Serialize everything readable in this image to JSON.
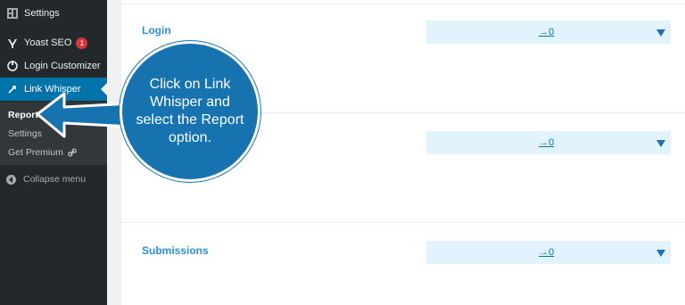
{
  "sidebar": {
    "items": [
      {
        "label": "Settings",
        "icon": "settings-icon"
      },
      {
        "label": "Yoast SEO",
        "icon": "yoast-icon",
        "badge": "1"
      },
      {
        "label": "Login Customizer",
        "icon": "customizer-icon"
      },
      {
        "label": "Link Whisper",
        "icon": "link-whisper-icon",
        "active": true
      }
    ],
    "submenu": [
      "Report",
      "Settings",
      "Get Premium"
    ],
    "collapse_label": "Collapse menu"
  },
  "main": {
    "rows": [
      {
        "label": "Login",
        "value": "→0"
      },
      {
        "label": "",
        "value": "→0"
      },
      {
        "label": "Submissions",
        "value": "→0"
      }
    ]
  },
  "callout": {
    "text": "Click on Link Whisper and select the Report option."
  },
  "colors": {
    "sidebar_bg": "#23282d",
    "active_bg": "#0073aa",
    "callout_bg": "#1773b0",
    "select_bg": "#e1f4fd",
    "label_color": "#2e8fd6"
  }
}
